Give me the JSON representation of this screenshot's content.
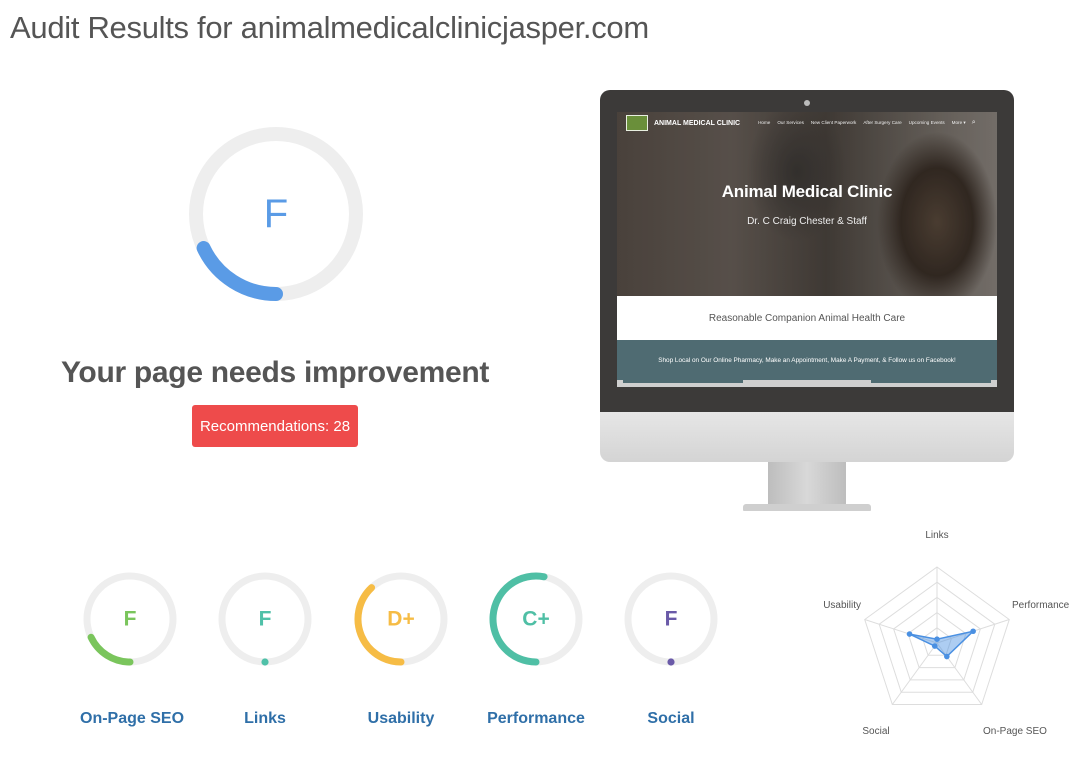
{
  "page": {
    "title": "Audit Results for animalmedicalclinicjasper.com"
  },
  "overall": {
    "grade": "F",
    "score_fraction": 0.18,
    "color": "#5a9be6",
    "headline": "Your page needs improvement",
    "recommendations_label": "Recommendations: 28"
  },
  "site_preview": {
    "brand": "ANIMAL MEDICAL CLINIC",
    "menu": [
      "Home",
      "Our Services",
      "New Client Paperwork",
      "After Surgery Care",
      "Upcoming Events",
      "More ▾"
    ],
    "hero_title": "Animal Medical Clinic",
    "hero_subtitle": "Dr. C Craig Chester & Staff",
    "tagline": "Reasonable Companion Animal Health Care",
    "banner": "Shop Local on Our Online Pharmacy, Make an Appointment, Make A Payment, & Follow us on Facebook!"
  },
  "categories": [
    {
      "label": "On-Page SEO",
      "grade": "F",
      "fraction": 0.18,
      "color": "#7ac55c"
    },
    {
      "label": "Links",
      "grade": "F",
      "fraction": 0.0,
      "color": "#4fc0a8"
    },
    {
      "label": "Usability",
      "grade": "D+",
      "fraction": 0.38,
      "color": "#f6bc45"
    },
    {
      "label": "Performance",
      "grade": "C+",
      "fraction": 0.53,
      "color": "#4fbfa5"
    },
    {
      "label": "Social",
      "grade": "F",
      "fraction": 0.0,
      "color": "#6a5aa8"
    }
  ],
  "radar": {
    "labels": [
      "Links",
      "Performance",
      "On-Page SEO",
      "Social",
      "Usability"
    ],
    "values": [
      0.05,
      0.5,
      0.22,
      0.05,
      0.38
    ],
    "color": "#4a90e2"
  }
}
